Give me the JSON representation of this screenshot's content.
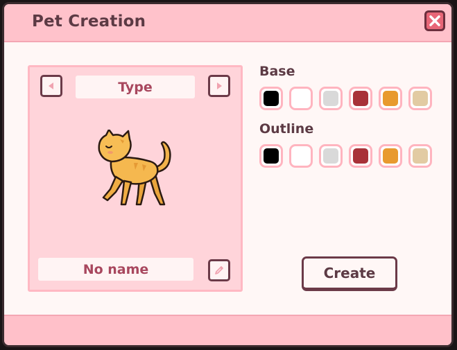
{
  "dialog": {
    "title": "Pet Creation",
    "close_icon": "close-x-icon"
  },
  "preview": {
    "type_label": "Type",
    "prev_icon": "triangle-left-icon",
    "next_icon": "triangle-right-icon",
    "pet": "orange-cat-sprite",
    "name_value": "No name",
    "edit_icon": "pencil-icon"
  },
  "colors": {
    "base_label": "Base",
    "outline_label": "Outline",
    "palette": [
      "#000000",
      "#ffffff",
      "#d9d9d9",
      "#a83238",
      "#e89a2e",
      "#e2cba3"
    ]
  },
  "actions": {
    "create_label": "Create"
  },
  "theme": {
    "accent": "#ffc0c9",
    "panel": "#ffd4da",
    "text": "#5c3a44",
    "label_text": "#a8475e",
    "close_button": "#e86677"
  }
}
